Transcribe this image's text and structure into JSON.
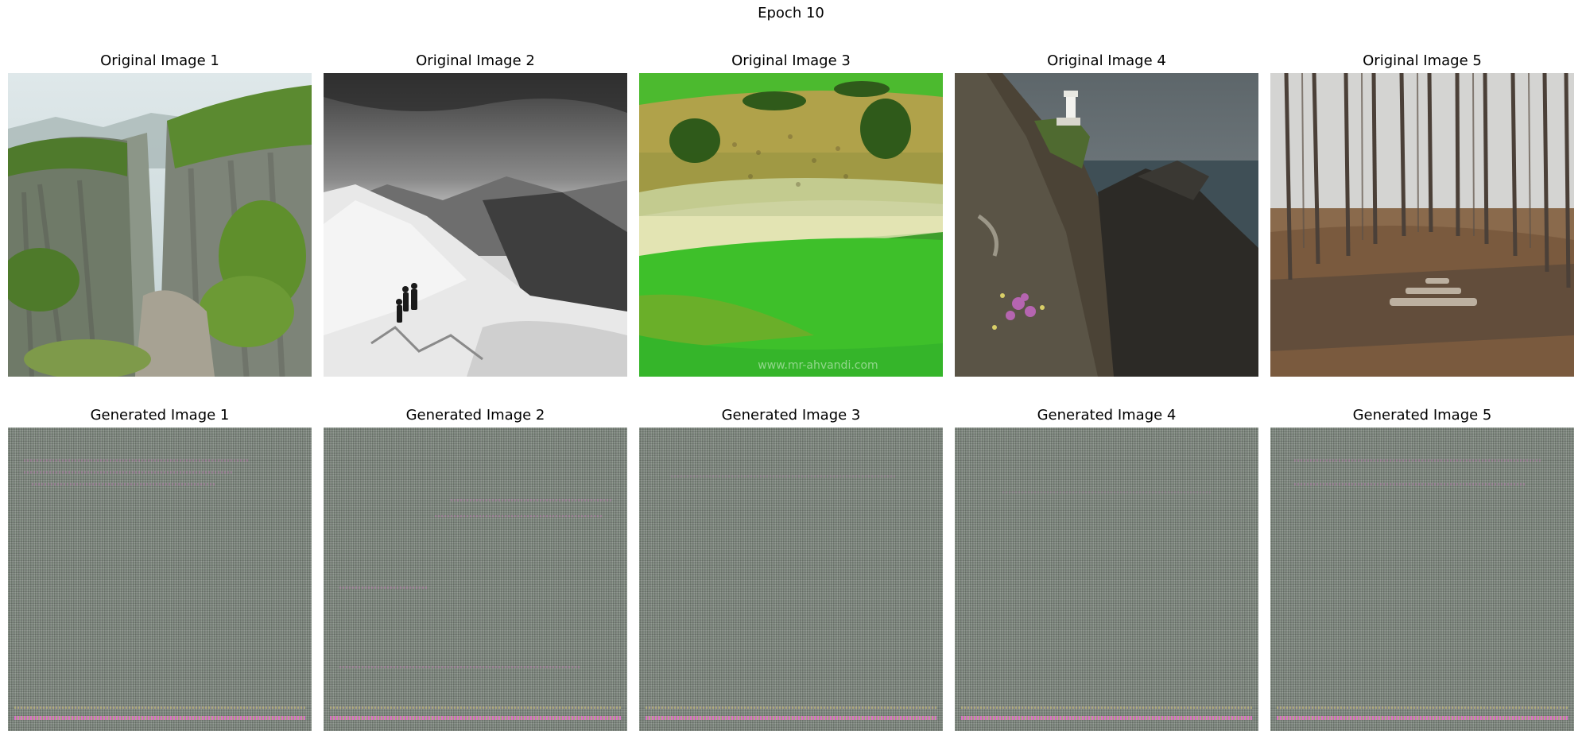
{
  "figure": {
    "title": "Epoch 10"
  },
  "original_row": {
    "titles": [
      "Original Image 1",
      "Original Image 2",
      "Original Image 3",
      "Original Image 4",
      "Original Image 5"
    ]
  },
  "generated_row": {
    "titles": [
      "Generated Image 1",
      "Generated Image 2",
      "Generated Image 3",
      "Generated Image 4",
      "Generated Image 5"
    ]
  },
  "watermark": "www.mr-ahvandi.com"
}
